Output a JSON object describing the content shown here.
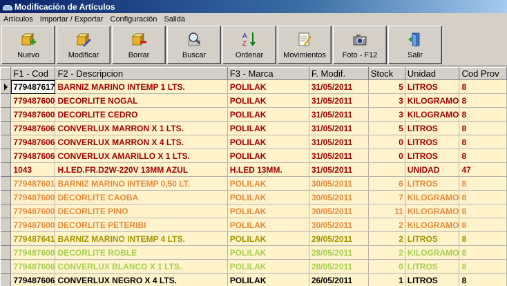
{
  "window": {
    "title": "Modificación de Artículos"
  },
  "menu": [
    "Artículos",
    "Importar / Exportar",
    "Configuración",
    "Salida"
  ],
  "toolbar": [
    {
      "label": "Nuevo",
      "icon": "new-box-icon"
    },
    {
      "label": "Modificar",
      "icon": "edit-box-icon"
    },
    {
      "label": "Borrar",
      "icon": "delete-box-icon"
    },
    {
      "label": "Buscar",
      "icon": "search-magnifier-icon"
    },
    {
      "label": "Ordenar",
      "icon": "sort-az-icon"
    },
    {
      "label": "Movimientos",
      "icon": "notepad-icon"
    },
    {
      "label": "Foto - F12",
      "icon": "camera-icon"
    },
    {
      "label": "Salir",
      "icon": "exit-door-icon"
    }
  ],
  "columns": [
    "F1 - Cod",
    "F2 - Descripcion",
    "F3 - Marca",
    "F. Modif.",
    "Stock",
    "Unidad",
    "Cod Prov"
  ],
  "colors": {
    "red": "#a00000",
    "orange": "#e68a3c",
    "olive": "#a29400",
    "green": "#a8d050",
    "black": "#000000",
    "row_bg": "#fff3cc"
  },
  "rows": [
    {
      "cod": "779487617",
      "desc": "BARNIZ MARINO INTEMP 1 LTS.",
      "marca": "POLILAK",
      "fecha": "31/05/2011",
      "stock": "5",
      "unidad": "LITROS",
      "prov": "8",
      "color": "red",
      "selected": true
    },
    {
      "cod": "779487600",
      "desc": "DECORLITE  NOGAL",
      "marca": "POLILAK",
      "fecha": "31/05/2011",
      "stock": "3",
      "unidad": "KILOGRAMO",
      "prov": "8",
      "color": "red"
    },
    {
      "cod": "779487600",
      "desc": "DECORLITE  CEDRO",
      "marca": "POLILAK",
      "fecha": "31/05/2011",
      "stock": "3",
      "unidad": "KILOGRAMO",
      "prov": "8",
      "color": "red"
    },
    {
      "cod": "779487606",
      "desc": "CONVERLUX MARRON X 1 LTS.",
      "marca": "POLILAK",
      "fecha": "31/05/2011",
      "stock": "5",
      "unidad": "LITROS",
      "prov": "8",
      "color": "red"
    },
    {
      "cod": "779487606",
      "desc": "CONVERLUX MARRON X 4 LTS.",
      "marca": "POLILAK",
      "fecha": "31/05/2011",
      "stock": "0",
      "unidad": "LITROS",
      "prov": "8",
      "color": "red"
    },
    {
      "cod": "779487606",
      "desc": "CONVERLUX AMARILLO X 1 LTS.",
      "marca": "POLILAK",
      "fecha": "31/05/2011",
      "stock": "0",
      "unidad": "LITROS",
      "prov": "8",
      "color": "red"
    },
    {
      "cod": "1043",
      "desc": " H.LED.FR.D2W-220V 13MM AZUL",
      "marca": "H.LED 13MM.",
      "fecha": "31/05/2011",
      "stock": "",
      "unidad": "UNIDAD",
      "prov": "47",
      "color": "red"
    },
    {
      "cod": "779487601",
      "desc": "BARNIZ MARINO INTEMP 0,50 LT.",
      "marca": "POLILAK",
      "fecha": "30/05/2011",
      "stock": "6",
      "unidad": "LITROS",
      "prov": "8",
      "color": "orange"
    },
    {
      "cod": "779487600",
      "desc": "DECORLITE  CAOBA",
      "marca": "POLILAK",
      "fecha": "30/05/2011",
      "stock": "7",
      "unidad": "KILOGRAMO",
      "prov": "8",
      "color": "orange"
    },
    {
      "cod": "779487600",
      "desc": "DECORLITE  PINO",
      "marca": "POLILAK",
      "fecha": "30/05/2011",
      "stock": "11",
      "unidad": "KILOGRAMO",
      "prov": "8",
      "color": "orange"
    },
    {
      "cod": "779487600",
      "desc": "DECORLITE  PETERIBI",
      "marca": "POLILAK",
      "fecha": "30/05/2011",
      "stock": "2",
      "unidad": "KILOGRAMO",
      "prov": "8",
      "color": "orange"
    },
    {
      "cod": "779487641",
      "desc": "BARNIZ MARINO INTEMP 4 LTS.",
      "marca": "POLILAK",
      "fecha": "29/05/2011",
      "stock": "2",
      "unidad": "LITROS",
      "prov": "8",
      "color": "olive"
    },
    {
      "cod": "779487600",
      "desc": "DECORLITE  ROBLE",
      "marca": "POLILAK",
      "fecha": "28/05/2011",
      "stock": "2",
      "unidad": "KILOGRAMO",
      "prov": "8",
      "color": "green"
    },
    {
      "cod": "779487606",
      "desc": "CONVERLUX BLANCO X 1 LTS.",
      "marca": "POLILAK",
      "fecha": "28/05/2011",
      "stock": "0",
      "unidad": "LITROS",
      "prov": "8",
      "color": "green"
    },
    {
      "cod": "779487606",
      "desc": "CONVERLUX NEGRO X 4 LTS.",
      "marca": "POLILAK",
      "fecha": "26/05/2011",
      "stock": "1",
      "unidad": "LITROS",
      "prov": "8",
      "color": "black"
    }
  ]
}
